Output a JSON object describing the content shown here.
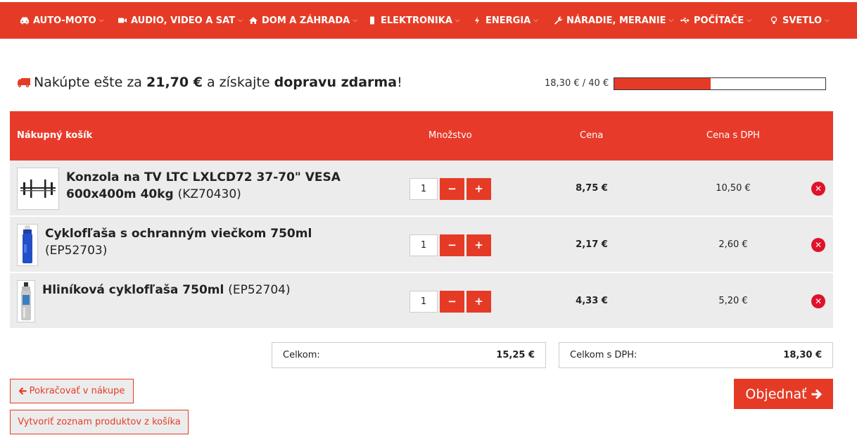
{
  "nav": {
    "items": [
      {
        "label": "AUTO-MOTO",
        "icon": "car-icon"
      },
      {
        "label": "AUDIO, VIDEO A SAT",
        "icon": "video-camera-icon"
      },
      {
        "label": "DOM A ZÁHRADA",
        "icon": "home-icon"
      },
      {
        "label": "ELEKTRONIKA",
        "icon": "mobile-icon"
      },
      {
        "label": "ENERGIA",
        "icon": "bolt-icon"
      },
      {
        "label": "NÁRADIE, MERANIE",
        "icon": "wrench-icon"
      },
      {
        "label": "POČÍTAČE",
        "icon": "usb-icon"
      },
      {
        "label": "SVETLO",
        "icon": "bulb-icon"
      }
    ]
  },
  "shipping": {
    "prefix": "Nakúpte ešte za",
    "amount": "21,70 €",
    "middle": "a získajte",
    "free": "dopravu zdarma",
    "suffix": "!",
    "progress_text": "18,30 € / 40 €",
    "progress_fraction": 0.4575
  },
  "cart": {
    "header": {
      "title": "Nákupný košík",
      "qty": "Množstvo",
      "price": "Cena",
      "price_vat": "Cena s DPH"
    },
    "items": [
      {
        "name": "Konzola na TV LTC LXLCD72 37-70\" VESA 600x400m 40kg",
        "code": "(KZ70430)",
        "qty": "1",
        "price": "8,75 €",
        "price_vat": "10,50 €"
      },
      {
        "name": "Cyklofľaša s ochranným viečkom 750ml",
        "code": "(EP52703)",
        "qty": "1",
        "price": "2,17 €",
        "price_vat": "2,60 €"
      },
      {
        "name": "Hliníková cyklofľaša 750ml",
        "code": "(EP52704)",
        "qty": "1",
        "price": "4,33 €",
        "price_vat": "5,20 €"
      }
    ],
    "minus_label": "−",
    "plus_label": "+",
    "remove_label": "✕"
  },
  "summary": {
    "total_label": "Celkom:",
    "total_value": "15,25 €",
    "total_vat_label": "Celkom s DPH:",
    "total_vat_value": "18,30 €"
  },
  "actions": {
    "continue": "Pokračovať v nákupe",
    "make_list": "Vytvoriť zoznam produktov z košíka",
    "order": "Objednať"
  },
  "colors": {
    "accent": "#e53b26",
    "row_bg": "#ececec",
    "remove": "#e0122a"
  }
}
